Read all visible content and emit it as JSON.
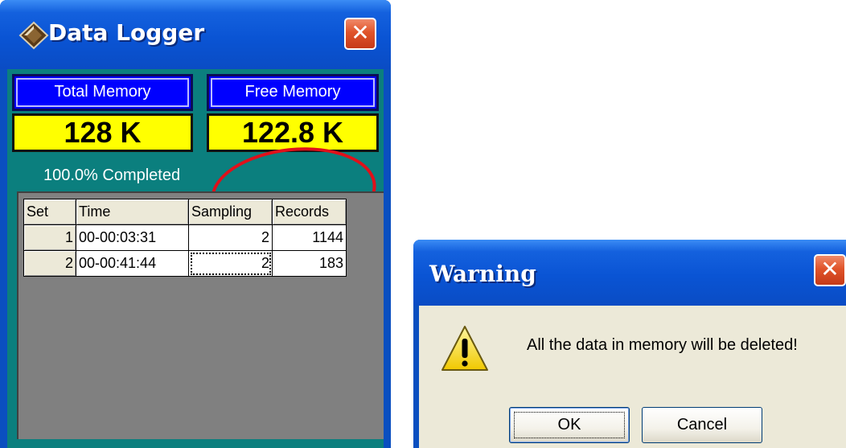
{
  "data_logger": {
    "title": "Data Logger",
    "close_glyph": "✕",
    "total_memory": {
      "label": "Total Memory",
      "value": "128 K"
    },
    "free_memory": {
      "label": "Free Memory",
      "value": "122.8 K"
    },
    "progress_text": "100.0% Completed",
    "table": {
      "headers": {
        "set": "Set",
        "time": "Time",
        "sampling": "Sampling",
        "records": "Records"
      },
      "rows": [
        {
          "set": "1",
          "time": "00-00:03:31",
          "sampling": "2",
          "records": "1144"
        },
        {
          "set": "2",
          "time": "00-00:41:44",
          "sampling": "2",
          "records": "183"
        }
      ]
    },
    "colors": {
      "titlebar": "#0a54d4",
      "client_teal": "#0b7f7e",
      "label_blue": "#0000ff",
      "value_yellow": "#ffff00",
      "annotation_red": "#e0101a"
    },
    "icons": {
      "title_icon": "logger-app-icon",
      "close_icon": "close-icon"
    }
  },
  "warning_dialog": {
    "title": "Warning",
    "close_glyph": "✕",
    "message": "All the data in memory will be deleted!",
    "ok_label": "OK",
    "cancel_label": "Cancel",
    "icons": {
      "warning_icon": "warning-icon"
    }
  }
}
